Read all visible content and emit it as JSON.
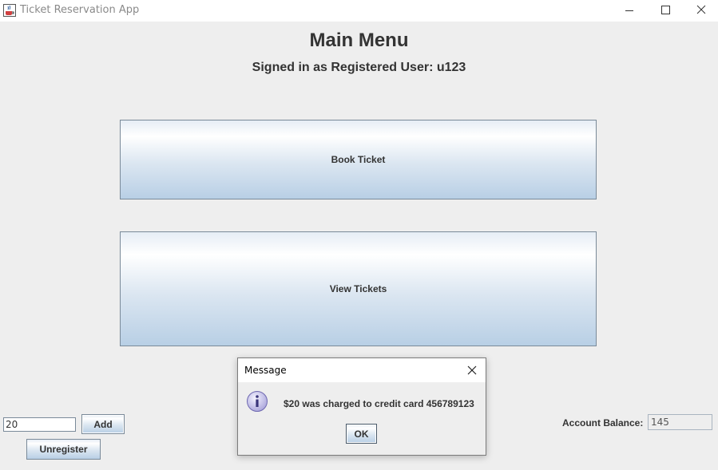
{
  "window": {
    "title": "Ticket Reservation App",
    "icon": "java-cup-icon"
  },
  "header": {
    "title": "Main Menu",
    "signed_in": "Signed in as Registered User: u123"
  },
  "menu": {
    "book_label": "Book Ticket",
    "view_label": "View Tickets"
  },
  "funds": {
    "amount_value": "20",
    "add_label": "Add",
    "unregister_label": "Unregister"
  },
  "balance": {
    "label": "Account Balance:",
    "value": "145"
  },
  "dialog": {
    "title": "Message",
    "icon": "info-icon",
    "message": "$20 was charged to credit card 456789123",
    "ok_label": "OK"
  },
  "colors": {
    "background": "#eeeeee",
    "button_gradient_bottom": "#b8cfe5",
    "info_icon": "#b7b3e0"
  }
}
